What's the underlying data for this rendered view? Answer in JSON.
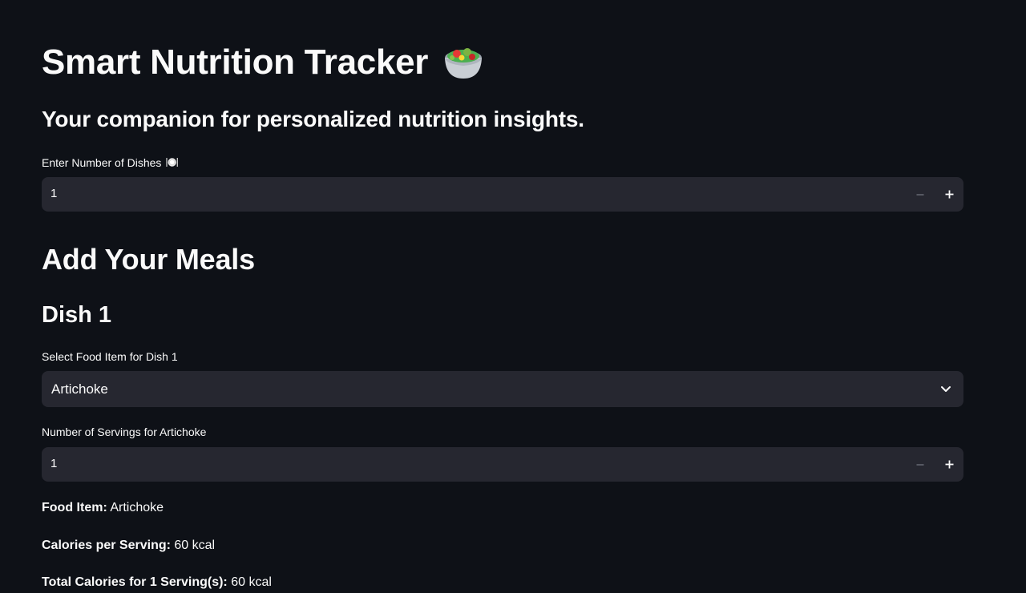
{
  "header": {
    "title": "Smart Nutrition Tracker",
    "title_icon": "salad-bowl-emoji",
    "subtitle": "Your companion for personalized nutrition insights."
  },
  "dishes_input": {
    "label": "Enter Number of Dishes",
    "label_icon": "plate-emoji",
    "value": "1",
    "decrement_icon": "minus-icon",
    "increment_icon": "plus-icon"
  },
  "meals_section": {
    "heading": "Add Your Meals"
  },
  "dish": {
    "heading": "Dish 1",
    "select_label": "Select Food Item for Dish 1",
    "selected_food": "Artichoke",
    "dropdown_icon": "chevron-down-icon",
    "servings_label": "Number of Servings for Artichoke",
    "servings_value": "1"
  },
  "summary": {
    "food_item_label": "Food Item:",
    "food_item_value": "Artichoke",
    "calories_label": "Calories per Serving:",
    "calories_value": "60 kcal",
    "total_label": "Total Calories for 1 Serving(s):",
    "total_value": "60 kcal"
  },
  "colors": {
    "background": "#0e1117",
    "input_background": "#262730",
    "text": "#fafafa"
  }
}
